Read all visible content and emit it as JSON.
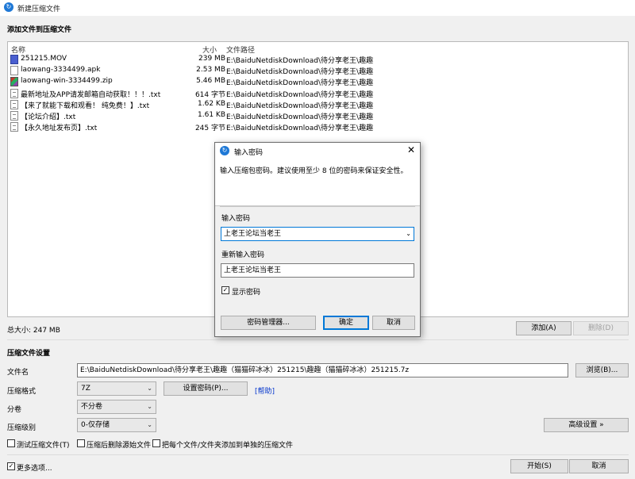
{
  "window": {
    "title": "新建压缩文件"
  },
  "add_files": {
    "section_title": "添加文件到压缩文件",
    "columns": {
      "name": "名称",
      "size": "大小",
      "path": "文件路径"
    },
    "files": [
      {
        "name": "251215.MOV",
        "size": "239 MB",
        "path": "E:\\BaiduNetdiskDownload\\待分享老王\\趣趣",
        "icon": "video-icon"
      },
      {
        "name": "laowang-3334499.apk",
        "size": "2.53 MB",
        "path": "E:\\BaiduNetdiskDownload\\待分享老王\\趣趣",
        "icon": "apk-icon"
      },
      {
        "name": "laowang-win-3334499.zip",
        "size": "5.46 MB",
        "path": "E:\\BaiduNetdiskDownload\\待分享老王\\趣趣",
        "icon": "archive-icon"
      },
      {
        "name": "最新地址及APP请发邮箱自动获取！！！.txt",
        "size": "614 字节",
        "path": "E:\\BaiduNetdiskDownload\\待分享老王\\趣趣",
        "icon": "text-file-icon"
      },
      {
        "name": "【来了就能下载和观看！ 纯免费！】.txt",
        "size": "1.62 KB",
        "path": "E:\\BaiduNetdiskDownload\\待分享老王\\趣趣",
        "icon": "text-file-icon"
      },
      {
        "name": "【论坛介绍】.txt",
        "size": "1.61 KB",
        "path": "E:\\BaiduNetdiskDownload\\待分享老王\\趣趣",
        "icon": "text-file-icon"
      },
      {
        "name": "【永久地址发布页】.txt",
        "size": "245 字节",
        "path": "E:\\BaiduNetdiskDownload\\待分享老王\\趣趣",
        "icon": "text-file-icon"
      }
    ],
    "total_size": "总大小: 247 MB",
    "add_button": "添加(A)",
    "delete_button": "删除(D)"
  },
  "settings": {
    "section_title": "压缩文件设置",
    "filename_label": "文件名",
    "filename_value": "E:\\BaiduNetdiskDownload\\待分享老王\\趣趣（猫猫碎冰冰）251215\\趣趣（猫猫碎冰冰）251215.7z",
    "browse_button": "浏览(B)...",
    "format_label": "压缩格式",
    "format_value": "7Z",
    "set_password_button": "设置密码(P)...",
    "help_link": "[帮助]",
    "split_label": "分卷",
    "split_value": "不分卷",
    "level_label": "压缩级别",
    "level_value": "0-仅存储",
    "advanced_button": "高级设置 »",
    "test_archive": "测试压缩文件(T)",
    "delete_source": "压缩后删除源始文件",
    "each_separate": "把每个文件/文件夹添加到单独的压缩文件",
    "more_options": "更多选项...",
    "start_button": "开始(S)",
    "cancel_button": "取消"
  },
  "password_dialog": {
    "title": "输入密码",
    "description": "输入压缩包密码。建议使用至少 8 位的密码来保证安全性。",
    "password_label": "输入密码",
    "password_value": "上老王论坛当老王",
    "confirm_label": "重新输入密码",
    "confirm_value": "上老王论坛当老王",
    "show_password": "显示密码",
    "show_password_checked": true,
    "manager_button": "密码管理器...",
    "ok_button": "确定",
    "cancel_button": "取消"
  },
  "colors": {
    "accent": "#0078d7",
    "app_icon": "#1e78d6",
    "link": "#0033cc"
  }
}
